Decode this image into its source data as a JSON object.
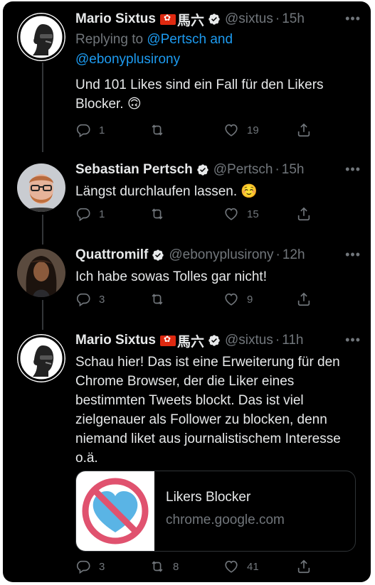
{
  "tweets": [
    {
      "name": "Mario Sixtus",
      "cjk": "馬六",
      "handle": "@sixtus",
      "time": "15h",
      "reply_label": "Replying to ",
      "reply_user1": "@Pertsch",
      "reply_and": " and",
      "reply_user2": "@ebonyplusirony",
      "text": "Und 101 Likes sind ein Fall für den Likers Blocker. 🙃",
      "replies": "1",
      "retweets": "",
      "likes": "19"
    },
    {
      "name": "Sebastian Pertsch",
      "handle": "@Pertsch",
      "time": "15h",
      "text": "Längst durchlaufen lassen. ☺️",
      "replies": "1",
      "retweets": "",
      "likes": "15"
    },
    {
      "name": "Quattromilf",
      "handle": "@ebonyplusirony",
      "time": "12h",
      "text": "Ich habe sowas Tolles gar nicht!",
      "replies": "3",
      "retweets": "",
      "likes": "9"
    },
    {
      "name": "Mario Sixtus",
      "cjk": "馬六",
      "handle": "@sixtus",
      "time": "11h",
      "text": "Schau hier! Das ist eine Erweiterung für den Chrome Browser, der die Liker eines bestimmten Tweets blockt. Das ist viel zielgenauer als Follower zu blocken, denn niemand liket aus journalistischem Interesse o.ä.",
      "card_title": "Likers Blocker",
      "card_domain": "chrome.google.com",
      "replies": "3",
      "retweets": "8",
      "likes": "41"
    }
  ],
  "ui": {
    "more": "•••",
    "dot": "·"
  },
  "colors": {
    "background": "#000000",
    "text": "#e7e9ea",
    "muted": "#71767b",
    "link": "#1d9bf0",
    "verified": "#e7e9ea",
    "flag": "#de2910"
  },
  "icons": [
    "reply-icon",
    "retweet-icon",
    "like-icon",
    "share-icon",
    "verified-badge-icon",
    "hong-kong-flag-icon",
    "more-icon"
  ]
}
